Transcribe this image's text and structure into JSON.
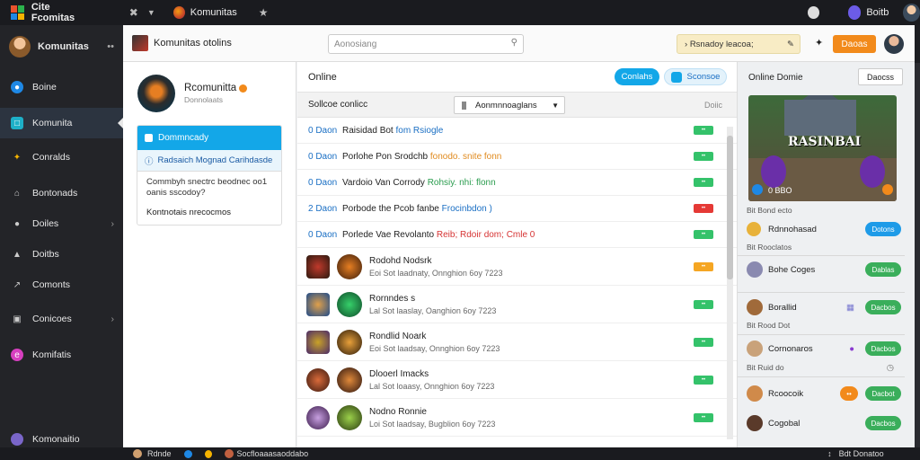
{
  "topbar": {
    "app_title": "Cite Fcomitas",
    "tab_label": "Komunitas",
    "user_name": "Boitb"
  },
  "sidebar": {
    "user_name": "Komunitas",
    "more": "••",
    "items": [
      {
        "label": "Boine",
        "icon": "globe-icon"
      },
      {
        "label": "Komunita",
        "icon": "community-icon"
      },
      {
        "label": "Conralds",
        "icon": "puzzle-icon"
      },
      {
        "label": "Bontonads",
        "icon": "bank-icon"
      },
      {
        "label": "Doiles",
        "icon": "people-icon"
      },
      {
        "label": "Doitbs",
        "icon": "group-icon"
      },
      {
        "label": "Comonts",
        "icon": "chart-icon"
      },
      {
        "label": "Conicoes",
        "icon": "folder-icon"
      },
      {
        "label": "Komifatis",
        "icon": "badge-icon"
      }
    ],
    "footer_label": "Komonaitio"
  },
  "main": {
    "title": "Komunitas otolins",
    "search_placeholder": "Aonosiang",
    "promo_text": "Rsnadoy leacoa;",
    "orange_button": "Daoas"
  },
  "left_panel": {
    "profile_name": "Rcomunitta",
    "profile_sub": "Donnolaats",
    "card_header": "Dommncady",
    "card_link": "Radsaich Mognad Carihdasde",
    "card_body": "Commbyh snectrc beodnec oo1 oanis sscodoy?",
    "card_footer": "Kontnotais nrecocmos"
  },
  "center_panel": {
    "title": "Online",
    "pill_primary": "Conlahs",
    "pill_secondary": "Sconsoe",
    "filter_label": "Sollcoe  conlicc",
    "select_value": "Aonmnnoaglans",
    "filter_right": "Doiic",
    "rows": [
      {
        "num": "0 Daon",
        "text": "Raisidad Bot",
        "extra": "fom Rsiogle",
        "badge": "ok",
        "badge_color": "#34c26a"
      },
      {
        "num": "0 Daon",
        "text": "Porlohe Pon Srodchb",
        "extra": "fonodo. snite fonn",
        "badge": "ok",
        "badge_color": "#34c26a"
      },
      {
        "num": "0 Daon",
        "text": "Vardoio Van Corrody",
        "extra": "Rohsiy. nhi: flonn",
        "badge": "ok",
        "badge_color": "#34c26a"
      },
      {
        "num": "2 Daon",
        "text": "Porbode the Pcob fanbe",
        "extra": "Frocinbdon )",
        "badge": "hot",
        "badge_color": "#e53935"
      },
      {
        "num": "0 Daon",
        "text": "Porlede Vae Revolanto",
        "extra": "Reib; Rdoir dom; Cmle 0",
        "badge": "ok",
        "badge_color": "#34c26a"
      }
    ],
    "members": [
      {
        "title": "Rodohd Nodsrk",
        "sub": "Eoi  Sot laadnaty, Onnghion 6oy 7223",
        "badge_color": "#f5a623"
      },
      {
        "title": "Rornndes s",
        "sub": "Lal  Sot laaslay, Oanghion 6oy 7223",
        "badge_color": "#34c26a"
      },
      {
        "title": "Rondlid Noark",
        "sub": "Eoi  Sot laadsay, Onnghion 6oy 7223",
        "badge_color": "#34c26a"
      },
      {
        "title": "Dlooerl Imacks",
        "sub": "Lal  Sot loaasy, Onnghion 6oy 7223",
        "badge_color": "#34c26a"
      },
      {
        "title": "Nodno Ronnie",
        "sub": "Loi  Sot laadsay, Bugblion 6oy 7223",
        "badge_color": "#34c26a"
      }
    ]
  },
  "right_panel": {
    "title": "Online  Domie",
    "button": "Daocss",
    "game_title": "RASINBAI",
    "game_stats": "0 BBO",
    "rows": [
      {
        "label": "Bit  Bond ecto",
        "btn": ""
      },
      {
        "label": "Rdnnohasad",
        "btn": "Dotons"
      },
      {
        "label": "Bit  Rooclatos",
        "btn": ""
      },
      {
        "label": "Bohe Coges",
        "btn": "Dablas"
      },
      {
        "label": "Borallid",
        "btn": "Dacbos"
      },
      {
        "label": "Bit  Rood Dot",
        "btn": ""
      },
      {
        "label": "Cornonaros",
        "btn": "Dacbos"
      },
      {
        "label": "Bit  Ruid do",
        "btn": ""
      },
      {
        "label": "Rcoocoik",
        "btn": "Dacbot"
      },
      {
        "label": "Cogobal",
        "btn": "Dacbos"
      }
    ],
    "btn_colors": {
      "blue": "#1e9be8",
      "green": "#3aae5b",
      "orange": "#f28a1b"
    }
  },
  "bottombar": {
    "left_label": "Rdnde",
    "mid_label": "Socfloaaasaoddabo",
    "right_label": "Bdt  Donatoo"
  }
}
